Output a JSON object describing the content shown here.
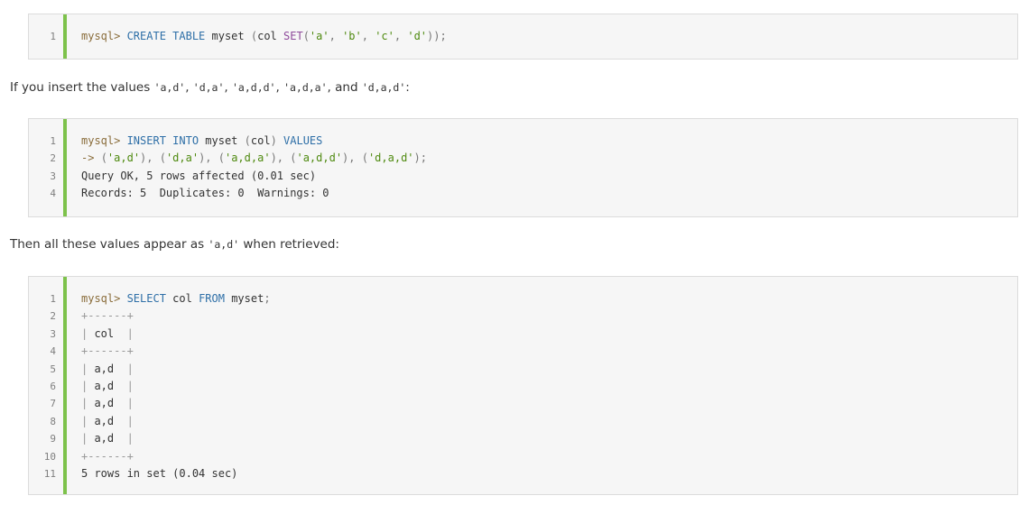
{
  "block1": {
    "lines": [
      [
        [
          "prompt",
          "mysql> "
        ],
        [
          "kw",
          "CREATE TABLE"
        ],
        [
          "plain",
          " myset "
        ],
        [
          "punct",
          "("
        ],
        [
          "plain",
          "col "
        ],
        [
          "fn",
          "SET"
        ],
        [
          "punct",
          "("
        ],
        [
          "str",
          "'a'"
        ],
        [
          "punct",
          ", "
        ],
        [
          "str",
          "'b'"
        ],
        [
          "punct",
          ", "
        ],
        [
          "str",
          "'c'"
        ],
        [
          "punct",
          ", "
        ],
        [
          "str",
          "'d'"
        ],
        [
          "punct",
          "));"
        ]
      ]
    ]
  },
  "paragraph1": [
    [
      "text",
      "If you insert the values "
    ],
    [
      "code",
      "'a,d'"
    ],
    [
      "text",
      ", "
    ],
    [
      "code",
      "'d,a'"
    ],
    [
      "text",
      ", "
    ],
    [
      "code",
      "'a,d,d'"
    ],
    [
      "text",
      ", "
    ],
    [
      "code",
      "'a,d,a'"
    ],
    [
      "text",
      ", and "
    ],
    [
      "code",
      "'d,a,d'"
    ],
    [
      "text",
      ":"
    ]
  ],
  "block2": {
    "lines": [
      [
        [
          "prompt",
          "mysql> "
        ],
        [
          "kw",
          "INSERT INTO"
        ],
        [
          "plain",
          " myset "
        ],
        [
          "punct",
          "("
        ],
        [
          "plain",
          "col"
        ],
        [
          "punct",
          ") "
        ],
        [
          "kw",
          "VALUES"
        ]
      ],
      [
        [
          "prompt",
          "-> "
        ],
        [
          "punct",
          "("
        ],
        [
          "str",
          "'a,d'"
        ],
        [
          "punct",
          "), ("
        ],
        [
          "str",
          "'d,a'"
        ],
        [
          "punct",
          "), ("
        ],
        [
          "str",
          "'a,d,a'"
        ],
        [
          "punct",
          "), ("
        ],
        [
          "str",
          "'a,d,d'"
        ],
        [
          "punct",
          "), ("
        ],
        [
          "str",
          "'d,a,d'"
        ],
        [
          "punct",
          ");"
        ]
      ],
      [
        [
          "plain",
          "Query OK, 5 rows affected (0.01 sec)"
        ]
      ],
      [
        [
          "plain",
          "Records: 5  Duplicates: 0  Warnings: 0"
        ]
      ]
    ]
  },
  "paragraph2": [
    [
      "text",
      "Then all these values appear as "
    ],
    [
      "code",
      "'a,d'"
    ],
    [
      "text",
      " when retrieved:"
    ]
  ],
  "block3": {
    "lines": [
      [
        [
          "prompt",
          "mysql> "
        ],
        [
          "kw",
          "SELECT"
        ],
        [
          "plain",
          " col "
        ],
        [
          "kw",
          "FROM"
        ],
        [
          "plain",
          " myset"
        ],
        [
          "punct",
          ";"
        ]
      ],
      [
        [
          "border",
          "+------+"
        ]
      ],
      [
        [
          "border",
          "| "
        ],
        [
          "plain",
          "col"
        ],
        [
          "border",
          "  |"
        ]
      ],
      [
        [
          "border",
          "+------+"
        ]
      ],
      [
        [
          "border",
          "| "
        ],
        [
          "plain",
          "a,d"
        ],
        [
          "border",
          "  |"
        ]
      ],
      [
        [
          "border",
          "| "
        ],
        [
          "plain",
          "a,d"
        ],
        [
          "border",
          "  |"
        ]
      ],
      [
        [
          "border",
          "| "
        ],
        [
          "plain",
          "a,d"
        ],
        [
          "border",
          "  |"
        ]
      ],
      [
        [
          "border",
          "| "
        ],
        [
          "plain",
          "a,d"
        ],
        [
          "border",
          "  |"
        ]
      ],
      [
        [
          "border",
          "| "
        ],
        [
          "plain",
          "a,d"
        ],
        [
          "border",
          "  |"
        ]
      ],
      [
        [
          "border",
          "+------+"
        ]
      ],
      [
        [
          "plain",
          "5 rows in set (0.04 sec)"
        ]
      ]
    ]
  }
}
